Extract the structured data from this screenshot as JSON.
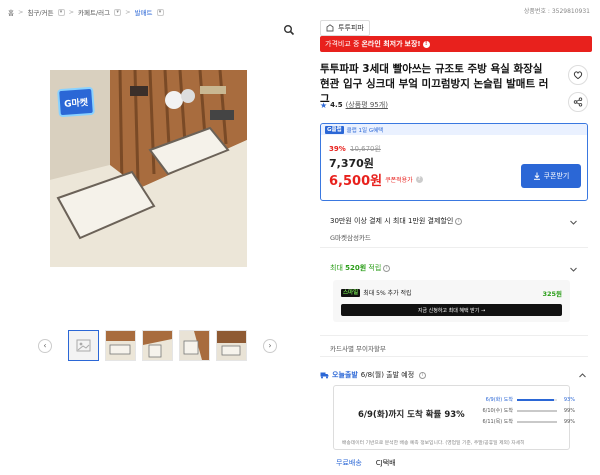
{
  "breadcrumb": {
    "items": [
      {
        "label": "홈",
        "dropdown": false
      },
      {
        "label": "침구/커튼",
        "dropdown": true
      },
      {
        "label": "카페트/러그",
        "dropdown": true
      },
      {
        "label": "발매트",
        "dropdown": true
      }
    ],
    "separator": ">",
    "product_number": "상품번호 : 3529810931"
  },
  "gallery": {
    "thumbnail_count_shown": 5,
    "prev_label": "‹",
    "next_label": "›",
    "badge": "G마켓"
  },
  "product": {
    "brand": "투투피파",
    "banner": {
      "prefix": "가격비교 중",
      "highlight": "온라인 최저가",
      "suffix": "보장!",
      "icon": "info-icon"
    },
    "title": "투투파파 3세대 빨아쓰는 규조토 주방 욕실 화장실 현관 입구 싱크대 부엌 미끄럼방지 논슬립 발매트 러그",
    "rating": {
      "score": "4.5",
      "count": "(상품평 95개)"
    }
  },
  "price": {
    "club_logo": "G클럽",
    "club_text": "클럽 1일 G혜택",
    "discount_pct": "39%",
    "original": "10,670원",
    "sale": "7,370원",
    "coupon_price": "6,500원",
    "coupon_text": "쿠폰적용가",
    "coupon_button": "쿠폰받기"
  },
  "rows": {
    "payment_discount": "30만원 이상 결제 시 최대 1만원 결제할인",
    "payment_card": "G마켓삼성카드",
    "reward_prefix": "최대",
    "reward_amount": "520원",
    "reward_suffix": "적립"
  },
  "reward_box": {
    "badge": "스마일",
    "text": "최대 5% 추가 적립",
    "points": "325원",
    "bar_text": "지금 신청하고 최대 혜택 받기 →"
  },
  "installment": "카드사별 무이자할부",
  "shipping": {
    "badge": "오늘출발",
    "head_text": "6/8(월) 출발 예정",
    "big_text": "6/9(화)까지 도착 확률 93%",
    "bars": [
      {
        "date": "6/9(화) 도착",
        "pct": "93%",
        "fraction": 0.93
      },
      {
        "date": "6/10(수) 도착",
        "pct": "99%",
        "fraction": 0.99
      },
      {
        "date": "6/11(목) 도착",
        "pct": "99%",
        "fraction": 0.99
      }
    ],
    "note": "배송데이터 기반으로 분석한 배송 예측 정보입니다. (영업일 기준, 주말/공휴일 제외) 자세히"
  },
  "tabs": {
    "free_shipping": "무료배송",
    "courier": "CJ택배"
  },
  "colors": {
    "accent": "#2b67d6",
    "red": "#e8211d",
    "green": "#2b9e19"
  }
}
